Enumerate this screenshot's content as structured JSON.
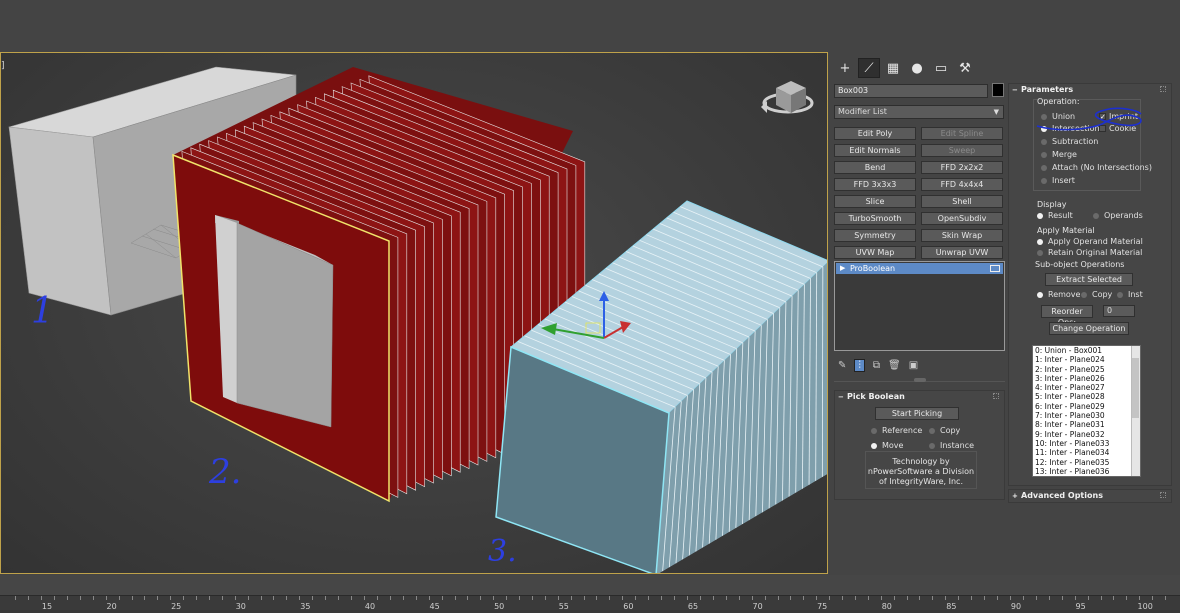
{
  "command_panel": {
    "tabs": [
      "create-icon",
      "modify-icon",
      "hierarchy-icon",
      "motion-icon",
      "display-icon",
      "utilities-icon"
    ],
    "object_name": "Box003",
    "modifier_list": "Modifier List",
    "modifier_buttons": [
      {
        "label": "Edit Poly",
        "enabled": true
      },
      {
        "label": "Edit Spline",
        "enabled": false
      },
      {
        "label": "Edit Normals",
        "enabled": true
      },
      {
        "label": "Sweep",
        "enabled": false
      },
      {
        "label": "Bend",
        "enabled": true
      },
      {
        "label": "FFD 2x2x2",
        "enabled": true
      },
      {
        "label": "FFD 3x3x3",
        "enabled": true
      },
      {
        "label": "FFD 4x4x4",
        "enabled": true
      },
      {
        "label": "Slice",
        "enabled": true
      },
      {
        "label": "Shell",
        "enabled": true
      },
      {
        "label": "TurboSmooth",
        "enabled": true
      },
      {
        "label": "OpenSubdiv",
        "enabled": true
      },
      {
        "label": "Symmetry",
        "enabled": true
      },
      {
        "label": "Skin Wrap",
        "enabled": true
      },
      {
        "label": "UVW Map",
        "enabled": true
      },
      {
        "label": "Unwrap UVW",
        "enabled": true
      }
    ],
    "stack_item": "ProBoolean"
  },
  "pick_boolean": {
    "title": "Pick Boolean",
    "start_picking": "Start Picking",
    "reference": "Reference",
    "copy": "Copy",
    "move": "Move",
    "instance": "Instance",
    "selected": "Move",
    "tech_line1": "Technology by",
    "tech_line2": "nPowerSoftware a Division",
    "tech_line3": "of IntegrityWare, Inc."
  },
  "parameters": {
    "title": "Parameters",
    "operation_label": "Operation:",
    "union": "Union",
    "intersection": "Intersection",
    "subtraction": "Subtraction",
    "merge": "Merge",
    "attach": "Attach (No Intersections)",
    "insert": "Insert",
    "imprint": "Imprint",
    "cookie": "Cookie",
    "imprint_checked": true,
    "selected_operation": "Intersection",
    "display_label": "Display",
    "result": "Result",
    "operands": "Operands",
    "display_selected": "Result",
    "apply_material_label": "Apply Material",
    "apply_operand_material": "Apply Operand Material",
    "retain_original_material": "Retain Original Material",
    "material_selected": "Apply Operand Material",
    "subobject_label": "Sub-object Operations",
    "extract_selected": "Extract Selected",
    "remove": "Remove",
    "copy": "Copy",
    "inst": "Inst",
    "extract_mode": "Remove",
    "reorder_label": "Reorder Ops:",
    "reorder_value": "0",
    "change_operation": "Change Operation",
    "operands_list": [
      "0: Union - Box001",
      "1: Inter - Plane024",
      "2: Inter - Plane025",
      "3: Inter - Plane026",
      "4: Inter - Plane027",
      "5: Inter - Plane028",
      "6: Inter - Plane029",
      "7: Inter - Plane030",
      "8: Inter - Plane031",
      "9: Inter - Plane032",
      "10: Inter - Plane033",
      "11: Inter - Plane034",
      "12: Inter - Plane035",
      "13: Inter - Plane036"
    ]
  },
  "advanced_options": {
    "title": "Advanced Options"
  },
  "viewport": {
    "annotations": [
      "1",
      "2.",
      "3."
    ],
    "bracket": "]"
  },
  "timeline": {
    "ticks": [
      "15",
      "20",
      "25",
      "30",
      "35",
      "40",
      "45",
      "50",
      "55",
      "60",
      "65",
      "70",
      "75",
      "80",
      "85",
      "90",
      "95",
      "100"
    ]
  }
}
